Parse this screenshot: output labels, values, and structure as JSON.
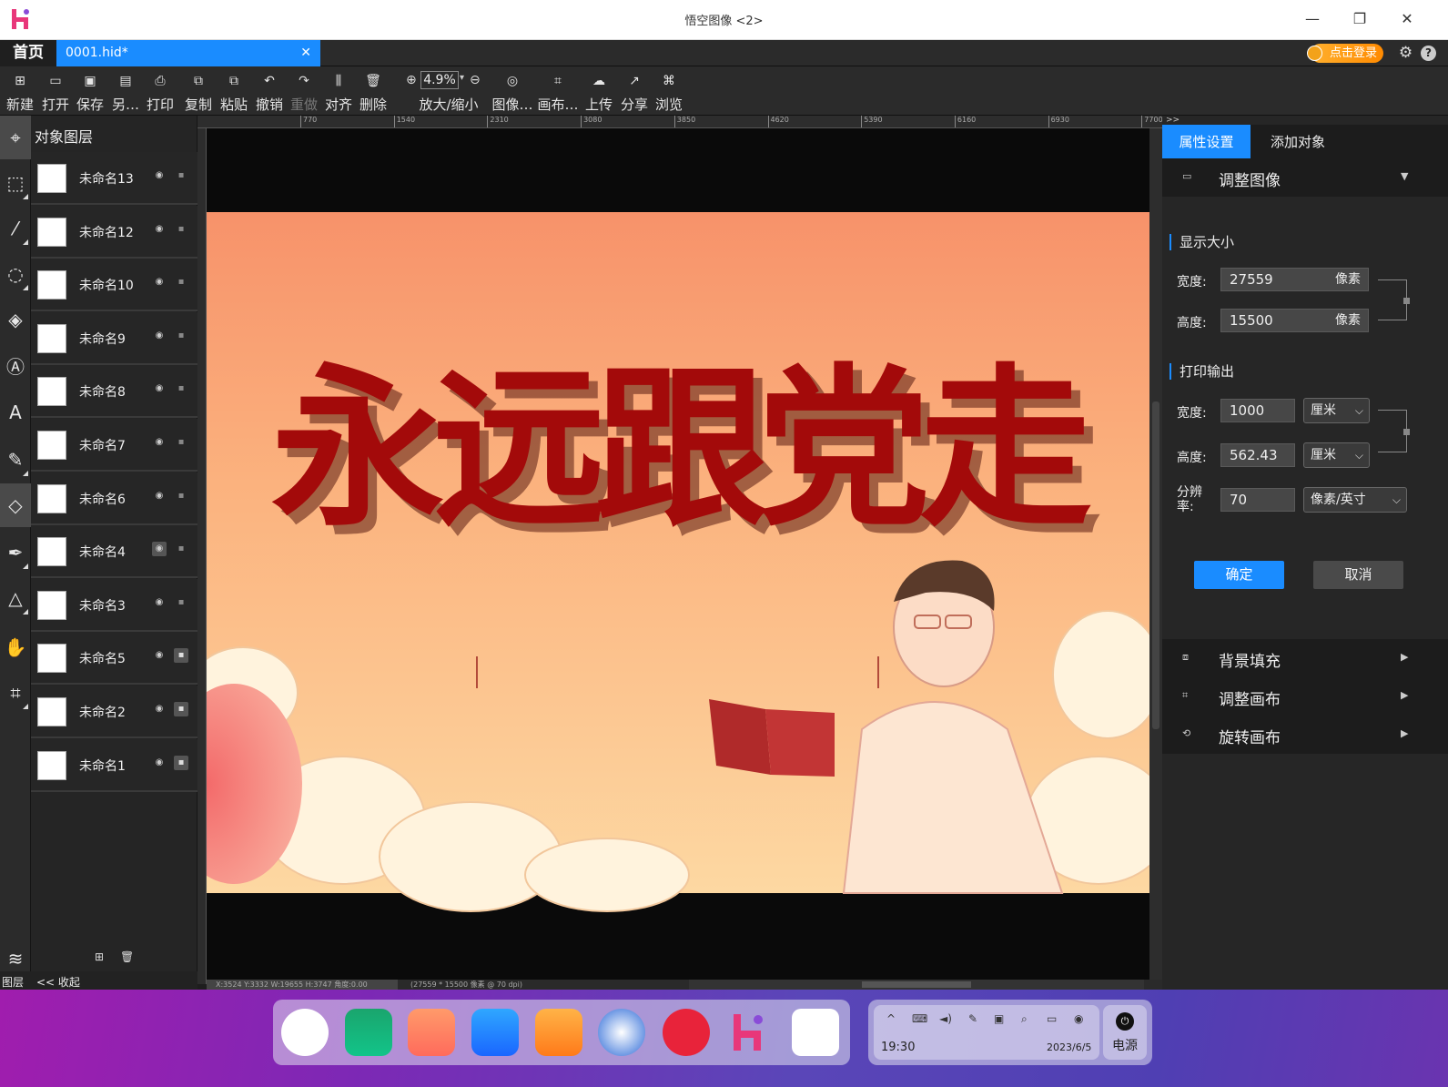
{
  "window": {
    "title": "悟空图像 <2>"
  },
  "tabs": {
    "home": "首页",
    "file": "0001.hid*",
    "login": "点击登录"
  },
  "toolbar": {
    "new": "新建",
    "open": "打开",
    "save": "保存",
    "save_as": "另…",
    "print": "打印",
    "copy": "复制",
    "paste": "粘贴",
    "undo": "撤销",
    "redo": "重做",
    "align": "对齐",
    "delete": "删除",
    "zoom": "放大/缩小",
    "zoom_value": "4.9%",
    "image": "图像…",
    "canvas": "画布…",
    "upload": "上传",
    "share": "分享",
    "browse": "浏览"
  },
  "layers": {
    "title": "对象图层",
    "items": [
      {
        "name": "未命名13",
        "visible": true,
        "locked": false
      },
      {
        "name": "未命名12",
        "visible": true,
        "locked": false
      },
      {
        "name": "未命名10",
        "visible": true,
        "locked": false
      },
      {
        "name": "未命名9",
        "visible": true,
        "locked": false
      },
      {
        "name": "未命名8",
        "visible": true,
        "locked": false
      },
      {
        "name": "未命名7",
        "visible": true,
        "locked": false
      },
      {
        "name": "未命名6",
        "visible": true,
        "locked": false
      },
      {
        "name": "未命名4",
        "visible": false,
        "locked": false
      },
      {
        "name": "未命名3",
        "visible": true,
        "locked": false
      },
      {
        "name": "未命名5",
        "visible": true,
        "locked": true
      },
      {
        "name": "未命名2",
        "visible": true,
        "locked": true
      },
      {
        "name": "未命名1",
        "visible": true,
        "locked": true
      }
    ],
    "footer_layers": "图层",
    "collapse": "<< 收起"
  },
  "ruler": {
    "ticks": [
      "770",
      "1540",
      "2310",
      "3080",
      "3850",
      "4620",
      "5390",
      "6160",
      "6930",
      "7700"
    ]
  },
  "canvas": {
    "banner_text": "永远跟党走"
  },
  "status": {
    "coords": "X:3524 Y:3332 W:19655 H:3747 角度:0.00",
    "dimensions": "(27559 * 15500 像素 @ 70 dpi)"
  },
  "props": {
    "tab_properties": "属性设置",
    "tab_add": "添加对象",
    "section_adjust": "调整图像",
    "display_size": "显示大小",
    "width_label": "宽度:",
    "height_label": "高度:",
    "display_width": "27559",
    "display_height": "15500",
    "unit_pixel": "像素",
    "print_output": "打印输出",
    "print_width": "1000",
    "print_height": "562.43",
    "unit_cm": "厘米",
    "resolution_label": "分辨率:",
    "resolution": "70",
    "resolution_unit": "像素/英寸",
    "ok": "确定",
    "cancel": "取消",
    "bg_fill": "背景填充",
    "adjust_canvas": "调整画布",
    "rotate_canvas": "旋转画布"
  },
  "taskbar": {
    "time": "19:30",
    "date": "2023/6/5",
    "power": "电源"
  },
  "colors": {
    "accent": "#1a8cff",
    "banner_text": "#a30a0a",
    "canvas_bg": "#fbc98a"
  }
}
